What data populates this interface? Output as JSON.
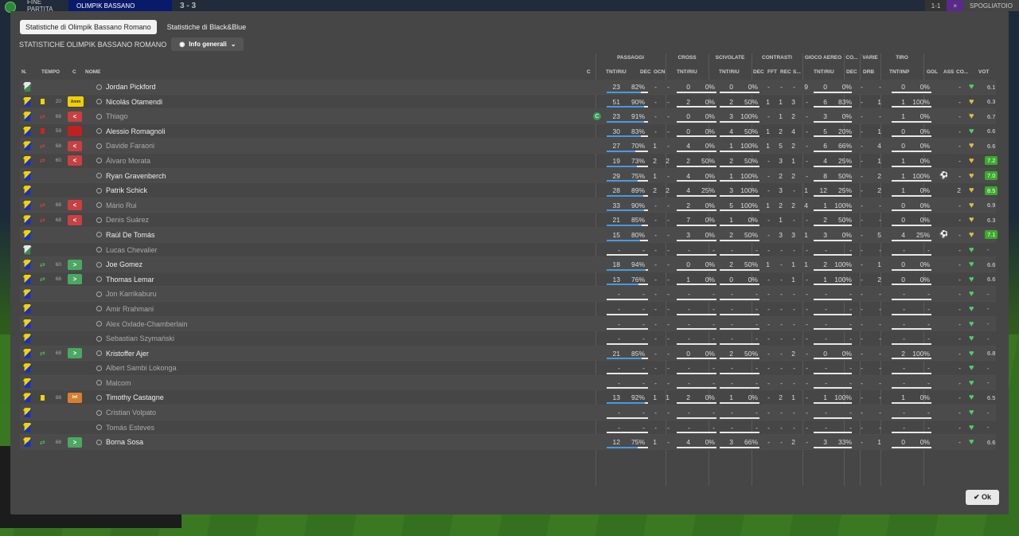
{
  "topbar": {
    "end_label": "FINE PARTITA",
    "team": "OLIMPIK BASSANO",
    "score": "3 - 3",
    "right1": "1-1",
    "right2": "×",
    "right3": "SPOGLIATOIO"
  },
  "tabs": [
    {
      "label": "Statistiche di Olimpik Bassano Romano"
    },
    {
      "label": "Statistiche di Black&Blue"
    }
  ],
  "subtitle": "STATISTICHE OLIMPIK BASSANO ROMANO",
  "dropdown": "Info generali",
  "groups": {
    "passaggi": "PASSAGGI",
    "cross": "CROSS",
    "scivolate": "SCIVOLATE",
    "contrasti": "CONTRASTI",
    "gioco_aereo": "GIOCO AEREO",
    "co": "CO...",
    "varie": "VARIE",
    "tiro": "TIRO"
  },
  "cols": {
    "n": "N.",
    "tempo": "TEMPO",
    "c": "C",
    "nome": "NOME",
    "c2": "C",
    "pass_tr": "TNT/RIU",
    "dec": "DEC",
    "ocn": "OCN",
    "cross_tr": "TNT/RIU",
    "sciv_tr": "TNT/RIU",
    "cdec": "DEC",
    "fft": "FFT",
    "rec": "REC",
    "s": "S...",
    "aer_tr": "TNT/RIU",
    "codec": "DEC",
    "drb": "DRB",
    "tiro_tr": "TNT/INP",
    "gol": "GOL",
    "ass": "ASS",
    "cond": "CO...",
    "vot": "VOT"
  },
  "players": [
    {
      "name": "Jordan Pickford",
      "gk": true,
      "tempo": "",
      "badge": "",
      "icon": "",
      "dim": false,
      "p": "23",
      "pp": "82%",
      "pf": 0.82,
      "dec": "-",
      "ocn": "-",
      "cr": "0",
      "crp": "0%",
      "sc": "0",
      "scp": "0%",
      "cdec": "-",
      "fft": "-",
      "rec": "-",
      "s": "9",
      "ae": "0",
      "aep": "0%",
      "codec": "-",
      "drb": "-",
      "ti": "0",
      "tip": "0%",
      "gol": "",
      "ass": "-",
      "heart": "g",
      "vot": "6.1",
      "votg": false
    },
    {
      "name": "Nicolás Otamendi",
      "gk": false,
      "tempo": "20",
      "badge": "amm",
      "icon": "yc",
      "dim": false,
      "p": "51",
      "pp": "90%",
      "pf": 0.9,
      "dec": "-",
      "ocn": "-",
      "cr": "2",
      "crp": "0%",
      "sc": "2",
      "scp": "50%",
      "cdec": "1",
      "fft": "1",
      "rec": "3",
      "s": "-",
      "ae": "6",
      "aep": "83%",
      "codec": "-",
      "drb": "1",
      "ti": "1",
      "tip": "100%",
      "gol": "",
      "ass": "-",
      "heart": "y",
      "vot": "6.3",
      "votg": false
    },
    {
      "name": "Thiago",
      "gk": false,
      "tempo": "68",
      "badge": "out",
      "icon": "out",
      "dim": true,
      "p": "23",
      "pp": "91%",
      "pf": 0.91,
      "dec": "-",
      "ocn": "-",
      "cr": "0",
      "crp": "0%",
      "sc": "3",
      "scp": "100%",
      "cdec": "-",
      "fft": "1",
      "rec": "2",
      "s": "-",
      "ae": "3",
      "aep": "0%",
      "codec": "-",
      "drb": "-",
      "ti": "1",
      "tip": "0%",
      "gol": "",
      "ass": "-",
      "heart": "y",
      "vot": "6.7",
      "votg": false,
      "capt": "C"
    },
    {
      "name": "Alessio Romagnoli",
      "gk": false,
      "tempo": "59",
      "badge": "red",
      "icon": "rc",
      "dim": false,
      "p": "30",
      "pp": "83%",
      "pf": 0.83,
      "dec": "-",
      "ocn": "-",
      "cr": "0",
      "crp": "0%",
      "sc": "4",
      "scp": "50%",
      "cdec": "1",
      "fft": "2",
      "rec": "4",
      "s": "-",
      "ae": "5",
      "aep": "20%",
      "codec": "-",
      "drb": "1",
      "ti": "0",
      "tip": "0%",
      "gol": "",
      "ass": "-",
      "heart": "g",
      "vot": "6.6",
      "votg": false
    },
    {
      "name": "Davide Faraoni",
      "gk": false,
      "tempo": "68",
      "badge": "out",
      "icon": "out",
      "dim": true,
      "p": "27",
      "pp": "70%",
      "pf": 0.7,
      "dec": "1",
      "ocn": "-",
      "cr": "4",
      "crp": "0%",
      "sc": "1",
      "scp": "100%",
      "cdec": "1",
      "fft": "5",
      "rec": "2",
      "s": "-",
      "ae": "6",
      "aep": "66%",
      "codec": "-",
      "drb": "4",
      "ti": "0",
      "tip": "0%",
      "gol": "",
      "ass": "-",
      "heart": "y",
      "vot": "6.6",
      "votg": false
    },
    {
      "name": "Álvaro Morata",
      "gk": false,
      "tempo": "60",
      "badge": "out",
      "icon": "out",
      "dim": true,
      "p": "19",
      "pp": "73%",
      "pf": 0.73,
      "dec": "2",
      "ocn": "2",
      "cr": "2",
      "crp": "50%",
      "sc": "2",
      "scp": "50%",
      "cdec": "-",
      "fft": "3",
      "rec": "1",
      "s": "-",
      "ae": "4",
      "aep": "25%",
      "codec": "-",
      "drb": "1",
      "ti": "1",
      "tip": "0%",
      "gol": "",
      "ass": "-",
      "heart": "y",
      "vot": "7.2",
      "votg": true
    },
    {
      "name": "Ryan Gravenberch",
      "gk": false,
      "tempo": "",
      "badge": "",
      "icon": "",
      "dim": false,
      "p": "29",
      "pp": "75%",
      "pf": 0.75,
      "dec": "1",
      "ocn": "-",
      "cr": "4",
      "crp": "0%",
      "sc": "1",
      "scp": "100%",
      "cdec": "-",
      "fft": "2",
      "rec": "2",
      "s": "-",
      "ae": "8",
      "aep": "50%",
      "codec": "-",
      "drb": "2",
      "ti": "1",
      "tip": "100%",
      "gol": "ball",
      "ass": "-",
      "heart": "o",
      "vot": "7.0",
      "votg": true
    },
    {
      "name": "Patrik Schick",
      "gk": false,
      "tempo": "",
      "badge": "",
      "icon": "",
      "dim": false,
      "p": "28",
      "pp": "89%",
      "pf": 0.89,
      "dec": "2",
      "ocn": "2",
      "cr": "4",
      "crp": "25%",
      "sc": "3",
      "scp": "100%",
      "cdec": "-",
      "fft": "3",
      "rec": "-",
      "s": "1",
      "ae": "12",
      "aep": "25%",
      "codec": "-",
      "drb": "2",
      "ti": "1",
      "tip": "0%",
      "gol": "",
      "ass": "2",
      "heart": "o",
      "vot": "8.5",
      "votg": true
    },
    {
      "name": "Mário Rui",
      "gk": false,
      "tempo": "68",
      "badge": "out",
      "icon": "out",
      "dim": true,
      "p": "33",
      "pp": "90%",
      "pf": 0.9,
      "dec": "-",
      "ocn": "-",
      "cr": "2",
      "crp": "0%",
      "sc": "5",
      "scp": "100%",
      "cdec": "1",
      "fft": "2",
      "rec": "2",
      "s": "4",
      "ae": "1",
      "aep": "100%",
      "codec": "-",
      "drb": "-",
      "ti": "0",
      "tip": "0%",
      "gol": "",
      "ass": "-",
      "heart": "o",
      "vot": "6.9",
      "votg": false
    },
    {
      "name": "Denis Suárez",
      "gk": false,
      "tempo": "68",
      "badge": "out",
      "icon": "out",
      "dim": true,
      "p": "21",
      "pp": "85%",
      "pf": 0.85,
      "dec": "-",
      "ocn": "-",
      "cr": "7",
      "crp": "0%",
      "sc": "1",
      "scp": "0%",
      "cdec": "-",
      "fft": "1",
      "rec": "-",
      "s": "-",
      "ae": "2",
      "aep": "50%",
      "codec": "-",
      "drb": "-",
      "ti": "0",
      "tip": "0%",
      "gol": "",
      "ass": "-",
      "heart": "y",
      "vot": "6.3",
      "votg": false
    },
    {
      "name": "Raúl De Tomás",
      "gk": false,
      "tempo": "",
      "badge": "",
      "icon": "",
      "dim": false,
      "p": "15",
      "pp": "80%",
      "pf": 0.8,
      "dec": "-",
      "ocn": "-",
      "cr": "3",
      "crp": "0%",
      "sc": "2",
      "scp": "50%",
      "cdec": "-",
      "fft": "3",
      "rec": "3",
      "s": "1",
      "ae": "3",
      "aep": "0%",
      "codec": "-",
      "drb": "5",
      "ti": "4",
      "tip": "25%",
      "gol": "ball",
      "ass": "-",
      "heart": "o",
      "vot": "7.1",
      "votg": true
    },
    {
      "name": "Lucas Chevalier",
      "gk": true,
      "tempo": "",
      "badge": "",
      "icon": "",
      "dim": true,
      "p": "-",
      "pp": "-",
      "pf": 0,
      "dec": "-",
      "ocn": "-",
      "cr": "-",
      "crp": "-",
      "sc": "-",
      "scp": "-",
      "cdec": "-",
      "fft": "-",
      "rec": "-",
      "s": "-",
      "ae": "-",
      "aep": "-",
      "codec": "-",
      "drb": "-",
      "ti": "-",
      "tip": "-",
      "gol": "",
      "ass": "-",
      "heart": "g",
      "vot": "-",
      "votg": false
    },
    {
      "name": "Joe Gomez",
      "gk": false,
      "tempo": "60",
      "badge": "in",
      "icon": "in",
      "dim": false,
      "p": "18",
      "pp": "94%",
      "pf": 0.94,
      "dec": "-",
      "ocn": "-",
      "cr": "0",
      "crp": "0%",
      "sc": "2",
      "scp": "50%",
      "cdec": "1",
      "fft": "-",
      "rec": "1",
      "s": "1",
      "ae": "2",
      "aep": "100%",
      "codec": "-",
      "drb": "1",
      "ti": "0",
      "tip": "0%",
      "gol": "",
      "ass": "-",
      "heart": "g",
      "vot": "6.6",
      "votg": false
    },
    {
      "name": "Thomas Lemar",
      "gk": false,
      "tempo": "68",
      "badge": "in",
      "icon": "in",
      "dim": false,
      "p": "13",
      "pp": "76%",
      "pf": 0.76,
      "dec": "-",
      "ocn": "-",
      "cr": "1",
      "crp": "0%",
      "sc": "0",
      "scp": "0%",
      "cdec": "-",
      "fft": "-",
      "rec": "1",
      "s": "-",
      "ae": "1",
      "aep": "100%",
      "codec": "-",
      "drb": "2",
      "ti": "0",
      "tip": "0%",
      "gol": "",
      "ass": "-",
      "heart": "g",
      "vot": "6.6",
      "votg": false
    },
    {
      "name": "Jon Karrikaburu",
      "gk": false,
      "tempo": "",
      "badge": "",
      "icon": "",
      "dim": true,
      "p": "-",
      "pp": "-",
      "pf": 0,
      "dec": "-",
      "ocn": "-",
      "cr": "-",
      "crp": "-",
      "sc": "-",
      "scp": "-",
      "cdec": "-",
      "fft": "-",
      "rec": "-",
      "s": "-",
      "ae": "-",
      "aep": "-",
      "codec": "-",
      "drb": "-",
      "ti": "-",
      "tip": "-",
      "gol": "",
      "ass": "-",
      "heart": "g",
      "vot": "-",
      "votg": false
    },
    {
      "name": "Amir Rrahmani",
      "gk": false,
      "tempo": "",
      "badge": "",
      "icon": "",
      "dim": true,
      "p": "-",
      "pp": "-",
      "pf": 0,
      "dec": "-",
      "ocn": "-",
      "cr": "-",
      "crp": "-",
      "sc": "-",
      "scp": "-",
      "cdec": "-",
      "fft": "-",
      "rec": "-",
      "s": "-",
      "ae": "-",
      "aep": "-",
      "codec": "-",
      "drb": "-",
      "ti": "-",
      "tip": "-",
      "gol": "",
      "ass": "-",
      "heart": "g",
      "vot": "-",
      "votg": false
    },
    {
      "name": "Alex Oxlade-Chamberlain",
      "gk": false,
      "tempo": "",
      "badge": "",
      "icon": "",
      "dim": true,
      "p": "-",
      "pp": "-",
      "pf": 0,
      "dec": "-",
      "ocn": "-",
      "cr": "-",
      "crp": "-",
      "sc": "-",
      "scp": "-",
      "cdec": "-",
      "fft": "-",
      "rec": "-",
      "s": "-",
      "ae": "-",
      "aep": "-",
      "codec": "-",
      "drb": "-",
      "ti": "-",
      "tip": "-",
      "gol": "",
      "ass": "-",
      "heart": "g",
      "vot": "-",
      "votg": false
    },
    {
      "name": "Sebastian Szymański",
      "gk": false,
      "tempo": "",
      "badge": "",
      "icon": "",
      "dim": true,
      "p": "-",
      "pp": "-",
      "pf": 0,
      "dec": "-",
      "ocn": "-",
      "cr": "-",
      "crp": "-",
      "sc": "-",
      "scp": "-",
      "cdec": "-",
      "fft": "-",
      "rec": "-",
      "s": "-",
      "ae": "-",
      "aep": "-",
      "codec": "-",
      "drb": "-",
      "ti": "-",
      "tip": "-",
      "gol": "",
      "ass": "-",
      "heart": "g",
      "vot": "-",
      "votg": false
    },
    {
      "name": "Kristoffer Ajer",
      "gk": false,
      "tempo": "68",
      "badge": "in",
      "icon": "in",
      "dim": false,
      "p": "21",
      "pp": "85%",
      "pf": 0.85,
      "dec": "-",
      "ocn": "-",
      "cr": "0",
      "crp": "0%",
      "sc": "2",
      "scp": "50%",
      "cdec": "-",
      "fft": "-",
      "rec": "2",
      "s": "-",
      "ae": "0",
      "aep": "0%",
      "codec": "-",
      "drb": "-",
      "ti": "2",
      "tip": "100%",
      "gol": "",
      "ass": "-",
      "heart": "g",
      "vot": "6.8",
      "votg": false
    },
    {
      "name": "Albert Sambi Lokonga",
      "gk": false,
      "tempo": "",
      "badge": "",
      "icon": "",
      "dim": true,
      "p": "-",
      "pp": "-",
      "pf": 0,
      "dec": "-",
      "ocn": "-",
      "cr": "-",
      "crp": "-",
      "sc": "-",
      "scp": "-",
      "cdec": "-",
      "fft": "-",
      "rec": "-",
      "s": "-",
      "ae": "-",
      "aep": "-",
      "codec": "-",
      "drb": "-",
      "ti": "-",
      "tip": "-",
      "gol": "",
      "ass": "-",
      "heart": "g",
      "vot": "-",
      "votg": false
    },
    {
      "name": "Malcom",
      "gk": false,
      "tempo": "",
      "badge": "",
      "icon": "",
      "dim": true,
      "p": "-",
      "pp": "-",
      "pf": 0,
      "dec": "-",
      "ocn": "-",
      "cr": "-",
      "crp": "-",
      "sc": "-",
      "scp": "-",
      "cdec": "-",
      "fft": "-",
      "rec": "-",
      "s": "-",
      "ae": "-",
      "aep": "-",
      "codec": "-",
      "drb": "-",
      "ti": "-",
      "tip": "-",
      "gol": "",
      "ass": "-",
      "heart": "g",
      "vot": "-",
      "votg": false
    },
    {
      "name": "Timothy Castagne",
      "gk": false,
      "tempo": "88",
      "badge": "inf",
      "icon": "yc",
      "dim": false,
      "p": "13",
      "pp": "92%",
      "pf": 0.92,
      "dec": "1",
      "ocn": "1",
      "cr": "2",
      "crp": "0%",
      "sc": "1",
      "scp": "0%",
      "cdec": "-",
      "fft": "2",
      "rec": "1",
      "s": "-",
      "ae": "1",
      "aep": "100%",
      "codec": "-",
      "drb": "-",
      "ti": "1",
      "tip": "0%",
      "gol": "",
      "ass": "-",
      "heart": "g",
      "vot": "6.5",
      "votg": false
    },
    {
      "name": "Cristian Volpato",
      "gk": false,
      "tempo": "",
      "badge": "",
      "icon": "",
      "dim": true,
      "p": "-",
      "pp": "-",
      "pf": 0,
      "dec": "-",
      "ocn": "-",
      "cr": "-",
      "crp": "-",
      "sc": "-",
      "scp": "-",
      "cdec": "-",
      "fft": "-",
      "rec": "-",
      "s": "-",
      "ae": "-",
      "aep": "-",
      "codec": "-",
      "drb": "-",
      "ti": "-",
      "tip": "-",
      "gol": "",
      "ass": "-",
      "heart": "g",
      "vot": "-",
      "votg": false
    },
    {
      "name": "Tomás Esteves",
      "gk": false,
      "tempo": "",
      "badge": "",
      "icon": "",
      "dim": true,
      "p": "-",
      "pp": "-",
      "pf": 0,
      "dec": "-",
      "ocn": "-",
      "cr": "-",
      "crp": "-",
      "sc": "-",
      "scp": "-",
      "cdec": "-",
      "fft": "-",
      "rec": "-",
      "s": "-",
      "ae": "-",
      "aep": "-",
      "codec": "-",
      "drb": "-",
      "ti": "-",
      "tip": "-",
      "gol": "",
      "ass": "-",
      "heart": "g",
      "vot": "-",
      "votg": false
    },
    {
      "name": "Borna Sosa",
      "gk": false,
      "tempo": "68",
      "badge": "in",
      "icon": "in",
      "dim": false,
      "p": "12",
      "pp": "75%",
      "pf": 0.75,
      "dec": "1",
      "ocn": "-",
      "cr": "4",
      "crp": "0%",
      "sc": "3",
      "scp": "66%",
      "cdec": "-",
      "fft": "-",
      "rec": "2",
      "s": "-",
      "ae": "3",
      "aep": "33%",
      "codec": "-",
      "drb": "1",
      "ti": "0",
      "tip": "0%",
      "gol": "",
      "ass": "-",
      "heart": "g",
      "vot": "6.6",
      "votg": false
    }
  ],
  "badges": {
    "amm": "Amm",
    "inf": "Inf",
    "out": "<",
    "in": ">",
    "red": ""
  },
  "ok_label": "Ok",
  "colors": {
    "modal": "#464646",
    "accent_bar": "#4a9ae0",
    "heart_green": "#4cd068",
    "vote_green": "#3aaa2a"
  }
}
